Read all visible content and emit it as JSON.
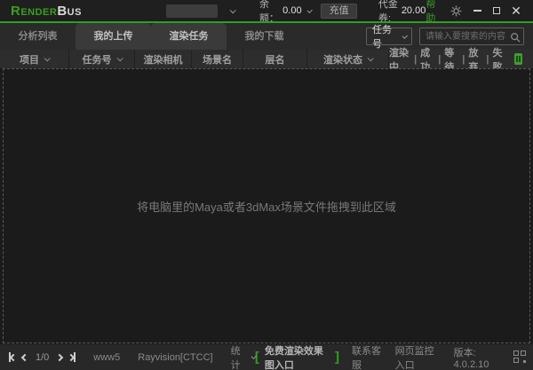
{
  "colors": {
    "accent": "#2da01e",
    "header_icon_green": "#3f9e2f"
  },
  "titlebar": {
    "logo_part1": "Render",
    "logo_part2": "Bus",
    "balance_label": "余额：",
    "balance_value": "0.00",
    "recharge_button": "充值",
    "voucher_label": "代金券:",
    "voucher_value": "20.00",
    "help_link": "帮助"
  },
  "tabs": [
    {
      "label": "分析列表"
    },
    {
      "label": "我的上传"
    },
    {
      "label": "渲染任务"
    },
    {
      "label": "我的下载"
    }
  ],
  "search": {
    "field_selector": "任务号",
    "placeholder": "请输入要搜索的内容"
  },
  "table": {
    "columns": [
      "项目",
      "任务号",
      "渲染相机",
      "场景名",
      "层名",
      "渲染状态"
    ],
    "status_filters": [
      "渲染中",
      "成功",
      "等待",
      "放弃",
      "失败"
    ],
    "filter_divider": "|"
  },
  "dropzone": {
    "hint": "将电脑里的Maya或者3dMax场景文件拖拽到此区域"
  },
  "statusbar": {
    "page": "1/0",
    "server": "www5",
    "cluster": "Rayvision[CTCC]",
    "stats_label": "统计",
    "bracket_left": "[",
    "bracket_right": "]",
    "free_render_link": "免费渲染效果图入口",
    "contact_link": "联系客服",
    "monitor_link": "网页监控入口",
    "version_label": "版本:",
    "version_value": "4.0.2.10"
  }
}
